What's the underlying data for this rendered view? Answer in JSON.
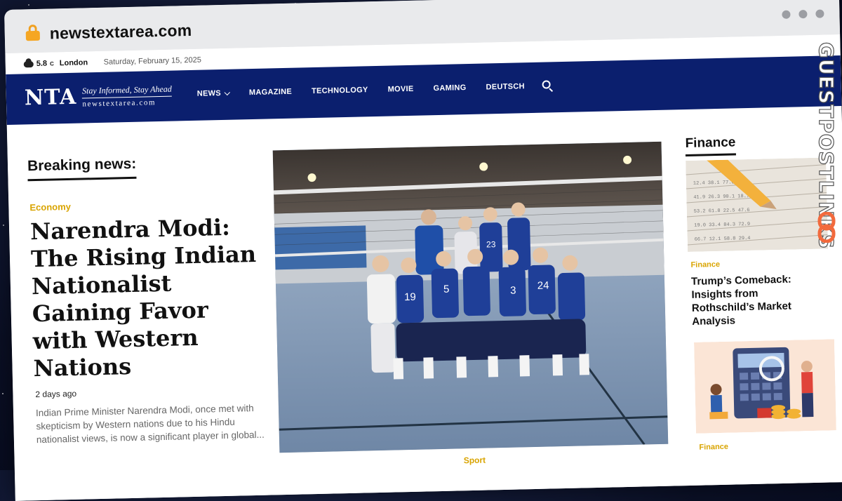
{
  "browser": {
    "url": "newstextarea.com"
  },
  "topbar": {
    "temp": "5.8",
    "temp_unit": "C",
    "city": "London",
    "date": "Saturday, February 15, 2025"
  },
  "logo": {
    "mark": "NTA",
    "tagline": "Stay Informed, Stay Ahead",
    "domain": "newstextarea.com"
  },
  "nav": {
    "items": [
      "NEWS",
      "MAGAZINE",
      "TECHNOLOGY",
      "MOVIE",
      "GAMING",
      "DEUTSCH"
    ]
  },
  "breaking": {
    "heading": "Breaking news:",
    "category": "Economy",
    "title": "Narendra Modi: The Rising Indian Nationalist Gaining Favor with Western Nations",
    "time": "2 days ago",
    "excerpt": "Indian Prime Minister Narendra Modi, once met with skepticism by Western nations due to his Hindu nationalist views, is now a significant player in global..."
  },
  "hero": {
    "jersey_numbers": [
      "19",
      "5",
      "3",
      "24",
      "23"
    ],
    "category": "Sport"
  },
  "finance": {
    "heading": "Finance",
    "articles": [
      {
        "category": "Finance",
        "title": "Trump’s Comeback: Insights from Rothschild’s Market Analysis"
      },
      {
        "category": "Finance"
      }
    ]
  },
  "watermark": {
    "text": "GUESTPOSTLINKS"
  },
  "colors": {
    "nav_bg": "#0b1f6e",
    "accent": "#d9a400",
    "watermark_icon": "#f26a3d"
  }
}
